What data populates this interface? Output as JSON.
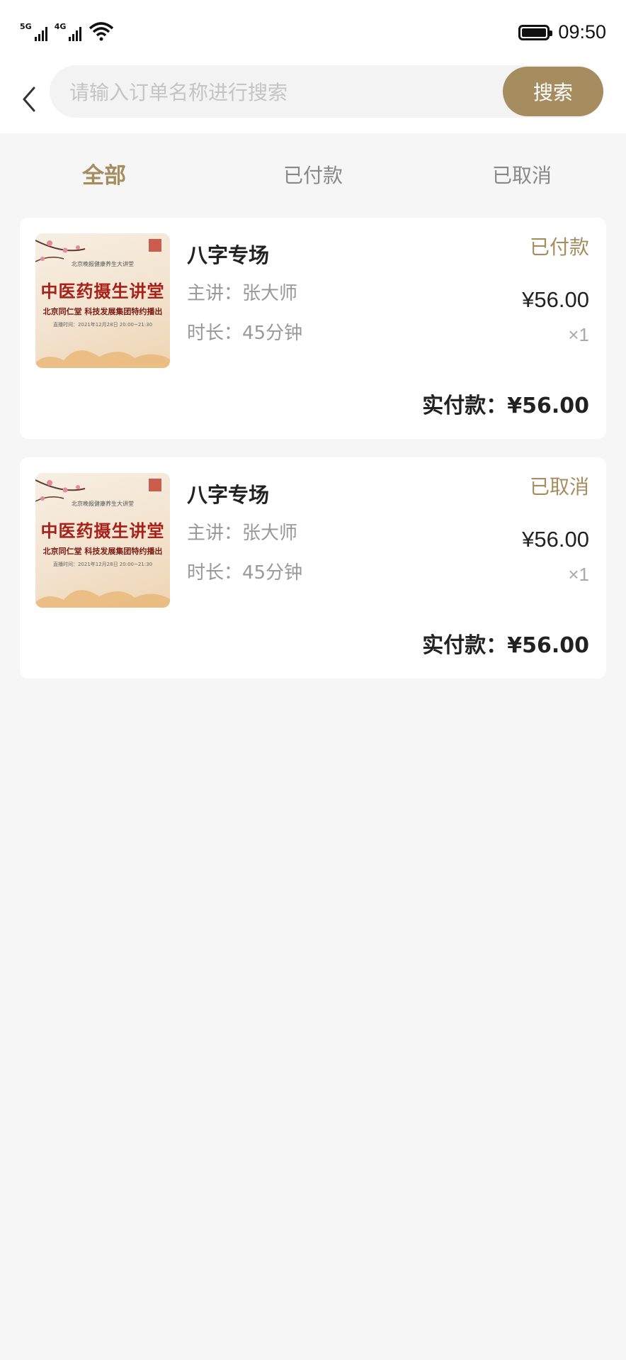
{
  "status_bar": {
    "signal1_label": "5G",
    "signal2_label": "4G",
    "time": "09:50",
    "icons": [
      "signal-icon",
      "wifi-icon",
      "battery-icon"
    ]
  },
  "search": {
    "placeholder": "请输入订单名称进行搜索",
    "value": "",
    "button_label": "搜索",
    "back_icon": "chevron-left-icon"
  },
  "tabs": [
    {
      "label": "全部",
      "active": true
    },
    {
      "label": "已付款",
      "active": false
    },
    {
      "label": "已取消",
      "active": false
    }
  ],
  "orders": [
    {
      "title": "八字专场",
      "lecturer": "主讲：张大师",
      "duration": "时长：45分钟",
      "status": "已付款",
      "price": "¥56.00",
      "quantity": "×1",
      "paid_label": "实付款：¥56.00",
      "poster": {
        "subtitle": "北京晚报健康养生大讲堂",
        "main": "中医药摄生讲堂",
        "line2": "北京同仁堂 科技发展集团特约播出",
        "line3": "直播时间：2021年12月28日 20:00~21:30"
      }
    },
    {
      "title": "八字专场",
      "lecturer": "主讲：张大师",
      "duration": "时长：45分钟",
      "status": "已取消",
      "price": "¥56.00",
      "quantity": "×1",
      "paid_label": "实付款：¥56.00",
      "poster": {
        "subtitle": "北京晚报健康养生大讲堂",
        "main": "中医药摄生讲堂",
        "line2": "北京同仁堂 科技发展集团特约播出",
        "line3": "直播时间：2021年12月28日 20:00~21:30"
      }
    }
  ],
  "colors": {
    "accent": "#a58d5f",
    "background": "#f6f6f6",
    "card": "#ffffff",
    "muted_text": "#999999"
  }
}
